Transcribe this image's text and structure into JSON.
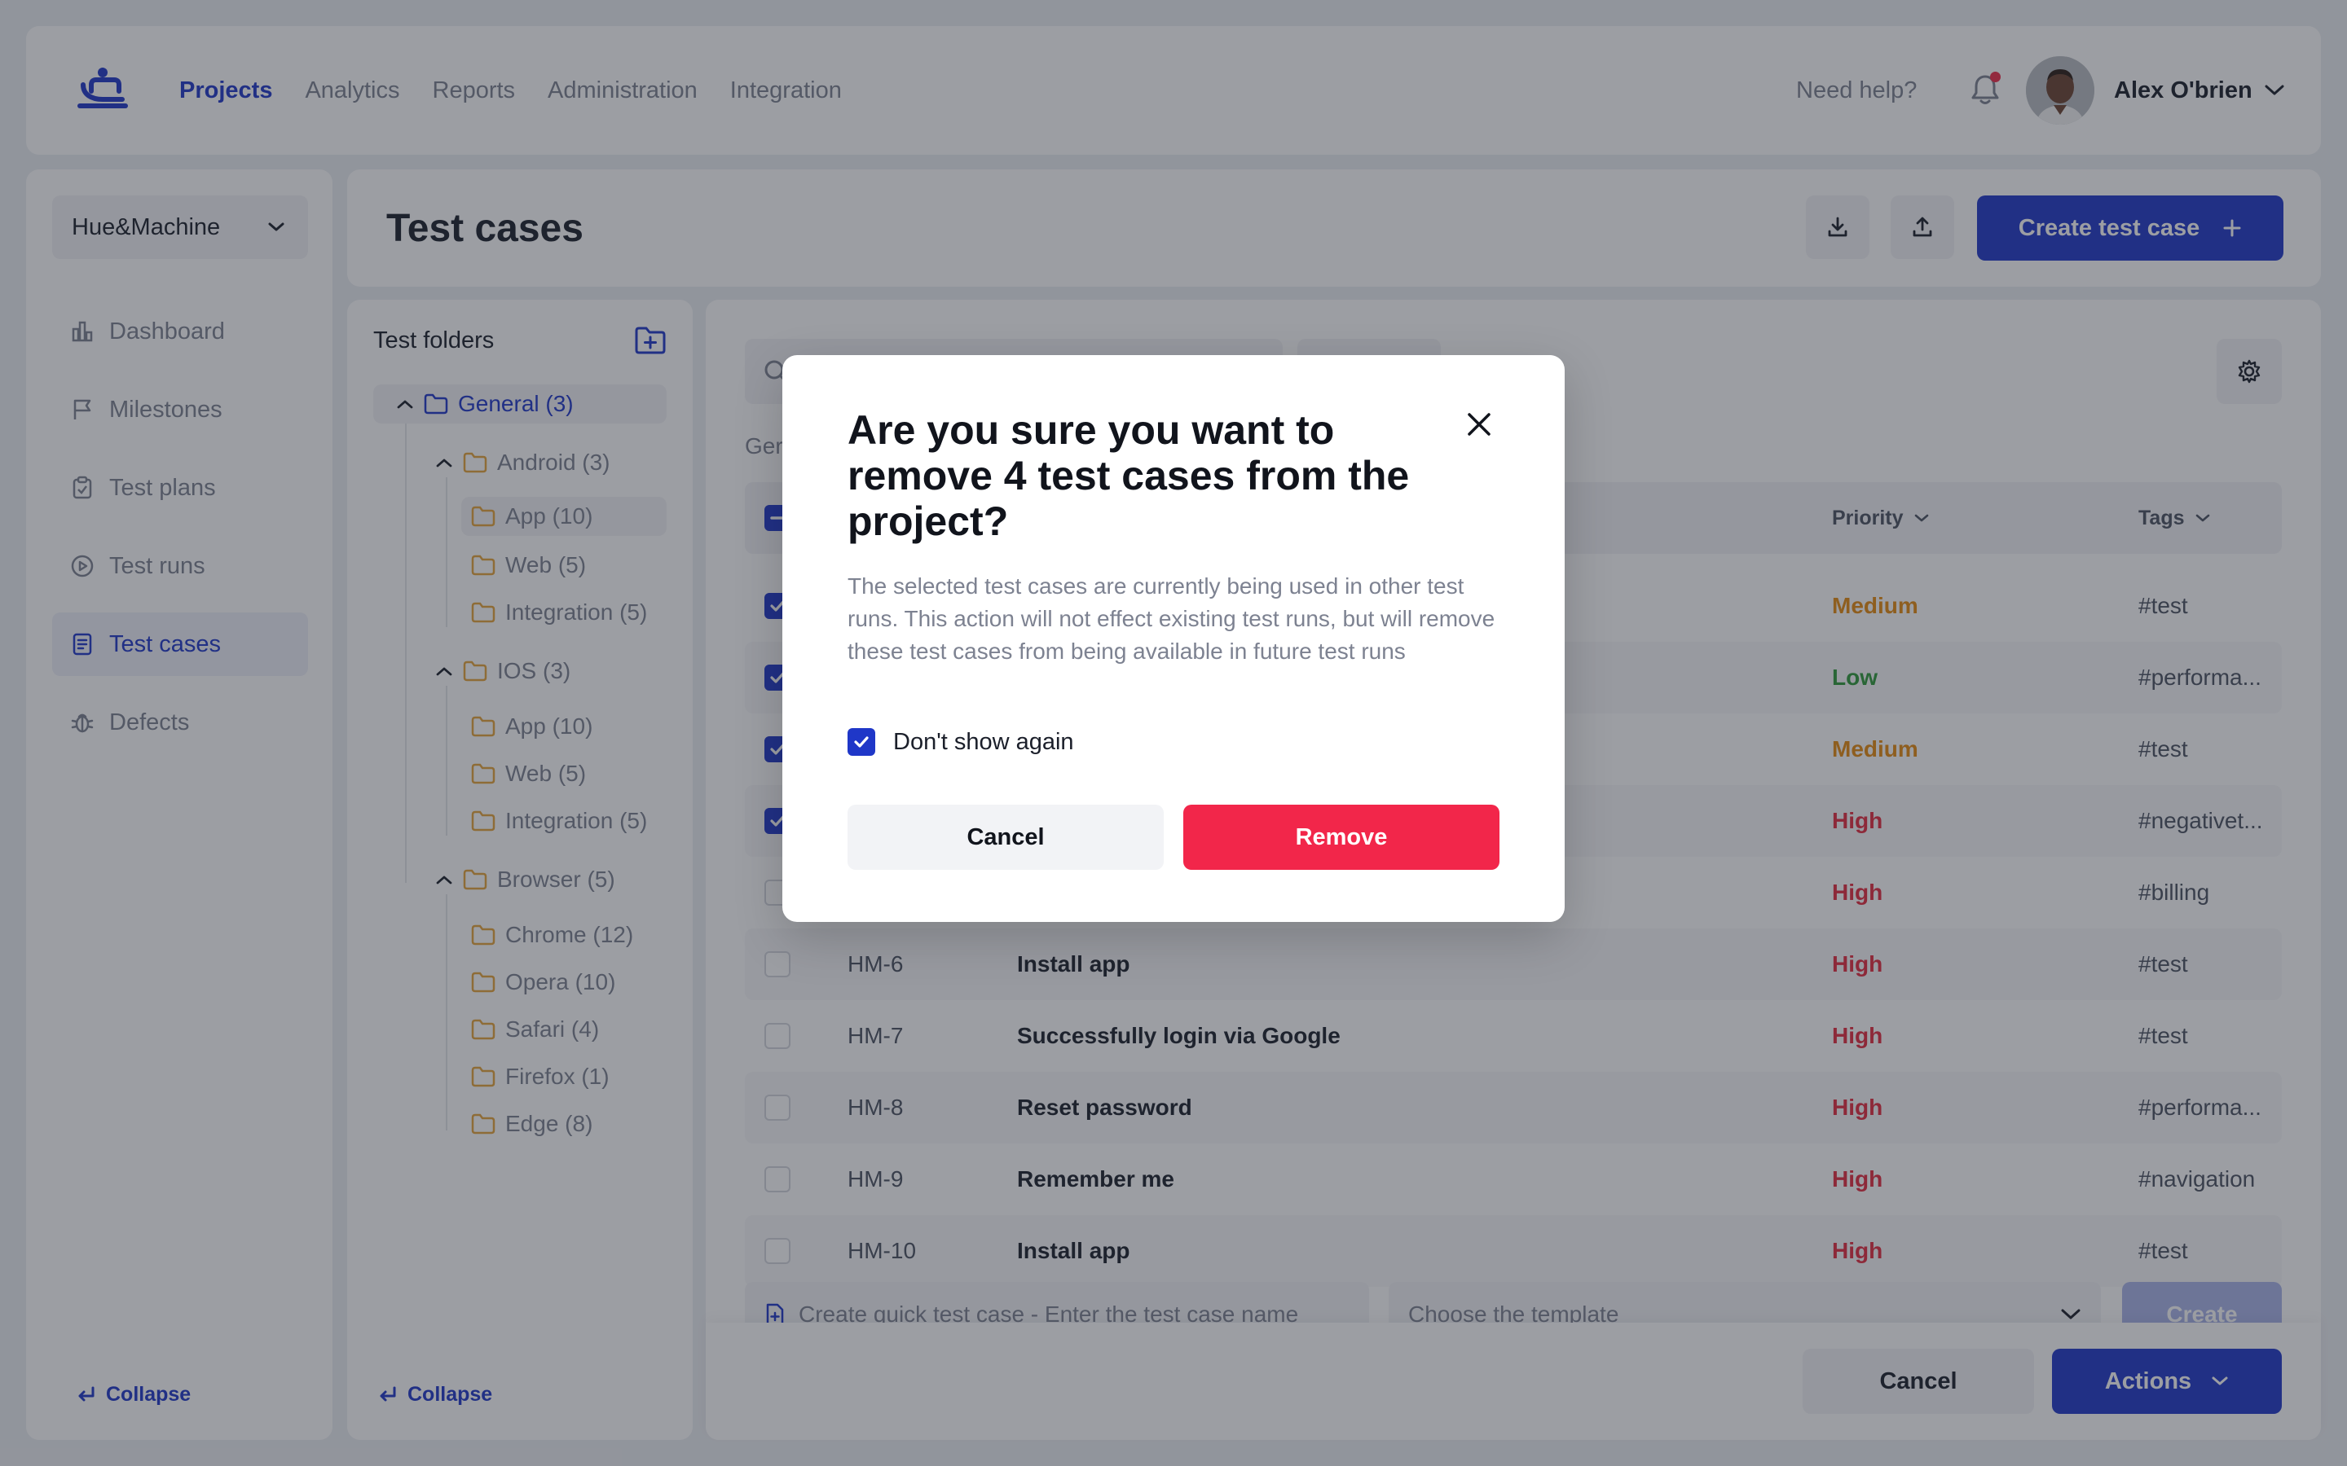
{
  "colors": {
    "accent": "#1f37c8",
    "danger": "#f2264a",
    "priority_high": "#e32b3f",
    "priority_medium": "#e58a10",
    "priority_low": "#2e9a3a"
  },
  "topnav": {
    "logo_icon": "hue-machine-logo-icon",
    "items": [
      {
        "label": "Projects",
        "active": true
      },
      {
        "label": "Analytics"
      },
      {
        "label": "Reports"
      },
      {
        "label": "Administration"
      },
      {
        "label": "Integration"
      }
    ],
    "help": "Need help?",
    "bell_icon": "bell-icon",
    "user_name": "Alex O'brien"
  },
  "sidebar": {
    "project": "Hue&Machine",
    "items": [
      {
        "label": "Dashboard",
        "icon": "dashboard-icon"
      },
      {
        "label": "Milestones",
        "icon": "flag-icon"
      },
      {
        "label": "Test plans",
        "icon": "clipboard-icon"
      },
      {
        "label": "Test runs",
        "icon": "play-circle-icon"
      },
      {
        "label": "Test cases",
        "icon": "document-list-icon",
        "active": true
      },
      {
        "label": "Defects",
        "icon": "bug-icon"
      }
    ],
    "collapse": "Collapse"
  },
  "header": {
    "title": "Test cases",
    "create_label": "Create test case"
  },
  "folders": {
    "title": "Test folders",
    "collapse": "Collapse",
    "tree": {
      "general": "General (3)",
      "android": "Android (3)",
      "android_app": "App (10)",
      "android_web": "Web (5)",
      "android_integration": "Integration (5)",
      "ios": "IOS (3)",
      "ios_app": "App (10)",
      "ios_web": "Web (5)",
      "ios_integration": "Integration (5)",
      "browser": "Browser (5)",
      "chrome": "Chrome (12)",
      "opera": "Opera (10)",
      "safari": "Safari (4)",
      "firefox": "Firefox (1)",
      "edge": "Edge (8)"
    }
  },
  "main": {
    "breadcrumb": "Ger",
    "columns": {
      "priority": "Priority",
      "tags": "Tags"
    },
    "rows": [
      {
        "id": "",
        "title": "",
        "priority": "Medium",
        "tag": "#test",
        "checked": true
      },
      {
        "id": "",
        "title": "",
        "priority": "Low",
        "tag": "#performa...",
        "checked": true
      },
      {
        "id": "",
        "title": "",
        "priority": "Medium",
        "tag": "#test",
        "checked": true
      },
      {
        "id": "",
        "title": "",
        "priority": "High",
        "tag": "#negativet...",
        "checked": true
      },
      {
        "id": "",
        "title": "",
        "priority": "High",
        "tag": "#billing",
        "checked": false
      },
      {
        "id": "HM-6",
        "title": "Install app",
        "priority": "High",
        "tag": "#test",
        "checked": false
      },
      {
        "id": "HM-7",
        "title": "Successfully login via Google",
        "priority": "High",
        "tag": "#test",
        "checked": false
      },
      {
        "id": "HM-8",
        "title": "Reset password",
        "priority": "High",
        "tag": "#performa...",
        "checked": false
      },
      {
        "id": "HM-9",
        "title": "Remember me",
        "priority": "High",
        "tag": "#navigation",
        "checked": false
      },
      {
        "id": "HM-10",
        "title": "Install app",
        "priority": "High",
        "tag": "#test",
        "checked": false
      }
    ],
    "quick_placeholder": "Create quick test case - Enter the test case name",
    "template_placeholder": "Choose the template",
    "create_label": "Create",
    "cancel_label": "Cancel",
    "actions_label": "Actions"
  },
  "modal": {
    "title": "Are you sure you want to remove 4 test cases from the project?",
    "body": "The selected test cases are currently being used in other test runs. This action will not effect existing test runs, but will remove these test cases from being available in future test runs",
    "checkbox_label": "Don't show again",
    "checkbox_checked": true,
    "cancel_label": "Cancel",
    "remove_label": "Remove"
  }
}
